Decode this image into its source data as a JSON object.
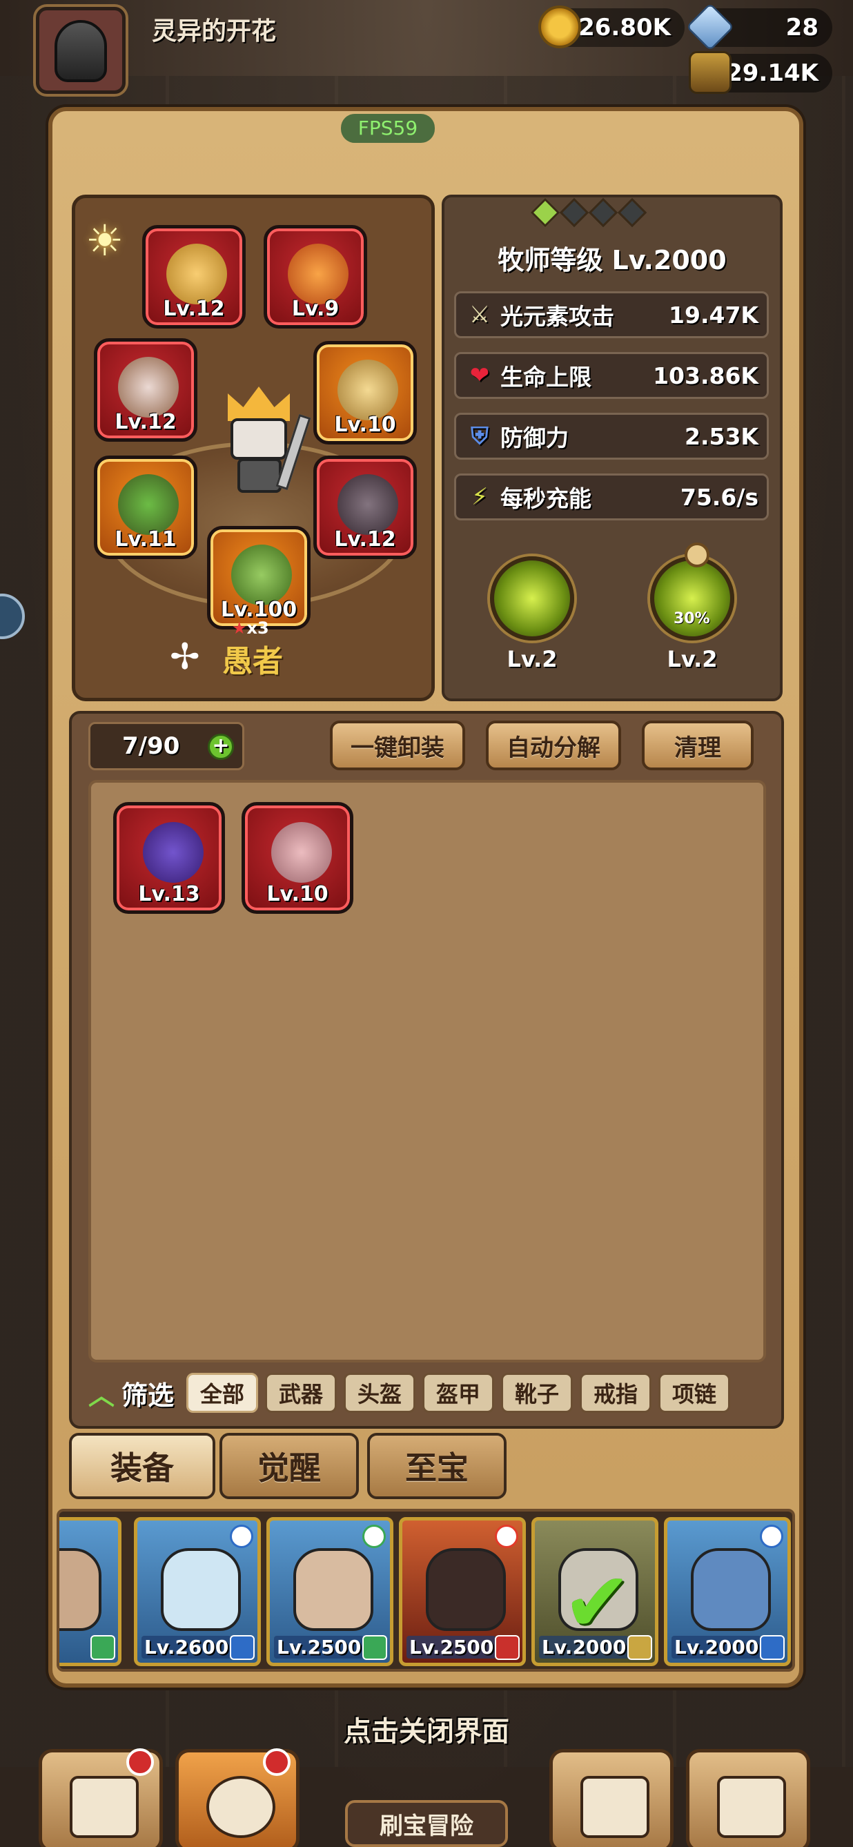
{
  "player": {
    "name": "灵异的开花"
  },
  "resources": {
    "coins": "126.80K",
    "gems": "28",
    "potions": "29.14K"
  },
  "fps": "FPS59",
  "hero": {
    "class_name": "愚者",
    "star_count": "x3",
    "equipment": [
      {
        "slot": "goblet",
        "level": "Lv.12",
        "rarity": "red"
      },
      {
        "slot": "amulet",
        "level": "Lv.9",
        "rarity": "red"
      },
      {
        "slot": "headdress",
        "level": "Lv.12",
        "rarity": "red"
      },
      {
        "slot": "sun-ring",
        "level": "Lv.10",
        "rarity": "orange"
      },
      {
        "slot": "armor",
        "level": "Lv.11",
        "rarity": "orange"
      },
      {
        "slot": "boots",
        "level": "Lv.12",
        "rarity": "red"
      },
      {
        "slot": "relic",
        "level": "Lv.100",
        "rarity": "orange"
      }
    ]
  },
  "stats": {
    "title": "牧师等级 Lv.2000",
    "rows": [
      {
        "icon": "sword-icon",
        "label": "光元素攻击",
        "value": "19.47K"
      },
      {
        "icon": "heart-icon",
        "label": "生命上限",
        "value": "103.86K"
      },
      {
        "icon": "shield-icon",
        "label": "防御力",
        "value": "2.53K"
      },
      {
        "icon": "charge-icon",
        "label": "每秒充能",
        "value": "75.6/s"
      }
    ],
    "skills": [
      {
        "level": "Lv.2"
      },
      {
        "level": "Lv.2",
        "badge": "30%"
      }
    ]
  },
  "inventory": {
    "count": "7/90",
    "buttons": [
      "一键卸装",
      "自动分解",
      "清理"
    ],
    "items": [
      {
        "name": "amulet",
        "level": "Lv.13"
      },
      {
        "name": "fan",
        "level": "Lv.10"
      }
    ],
    "filter_label": "筛选",
    "filters": [
      "全部",
      "武器",
      "头盔",
      "盔甲",
      "靴子",
      "戒指",
      "项链"
    ],
    "active_filter": "全部"
  },
  "tabs": [
    "装备",
    "觉醒",
    "至宝"
  ],
  "active_tab": "装备",
  "hero_cards": [
    {
      "level": "00"
    },
    {
      "level": "Lv.2600"
    },
    {
      "level": "Lv.2500"
    },
    {
      "level": "Lv.2500"
    },
    {
      "level": "Lv.2000",
      "selected": true
    },
    {
      "level": "Lv.2000"
    }
  ],
  "close_hint": "点击关闭界面",
  "bottom_nav": {
    "adventure_label": "刷宝冒险"
  },
  "colors": {
    "panel": "#c79d5f",
    "red_rarity": "#c3282e",
    "orange_rarity": "#f08a1c",
    "accent_green": "#6dc42f"
  }
}
